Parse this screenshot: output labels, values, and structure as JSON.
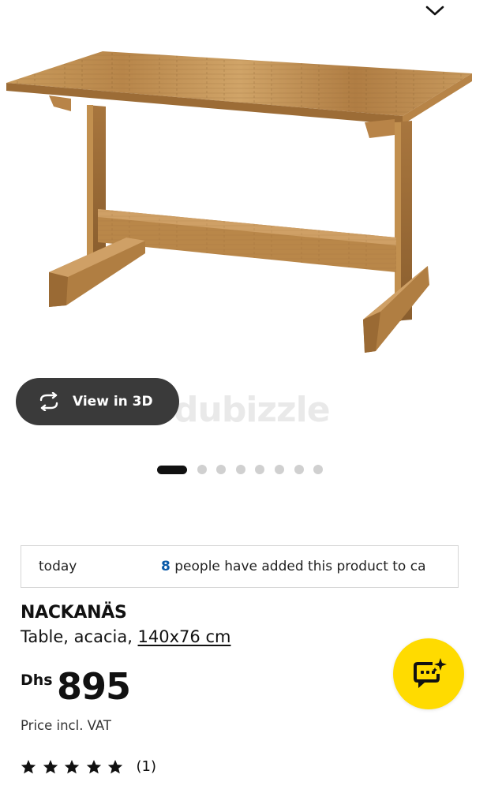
{
  "view3d": {
    "label": "View in 3D",
    "icon": "rotate-arrows-icon"
  },
  "watermark": {
    "text": "dubizzle"
  },
  "carousel": {
    "total": 8,
    "active_index": 0
  },
  "banner": {
    "today_label": "today",
    "count": "8",
    "message": " people have added this product to ca"
  },
  "product": {
    "name": "NACKANÄS",
    "description": "Table, acacia, ",
    "size": "140x76 cm",
    "currency": "Dhs",
    "price": "895",
    "vat_note": "Price incl. VAT",
    "rating": {
      "stars": 5,
      "max": 5,
      "reviews": "(1)"
    }
  },
  "chat": {
    "icon": "chat-bot-icon"
  },
  "colors": {
    "accent_yellow": "#ffdb00",
    "pill_bg": "#3a3a3a",
    "count_blue": "#0a5aa8",
    "dot_inactive": "#d0d0d0",
    "dot_active": "#111111"
  }
}
